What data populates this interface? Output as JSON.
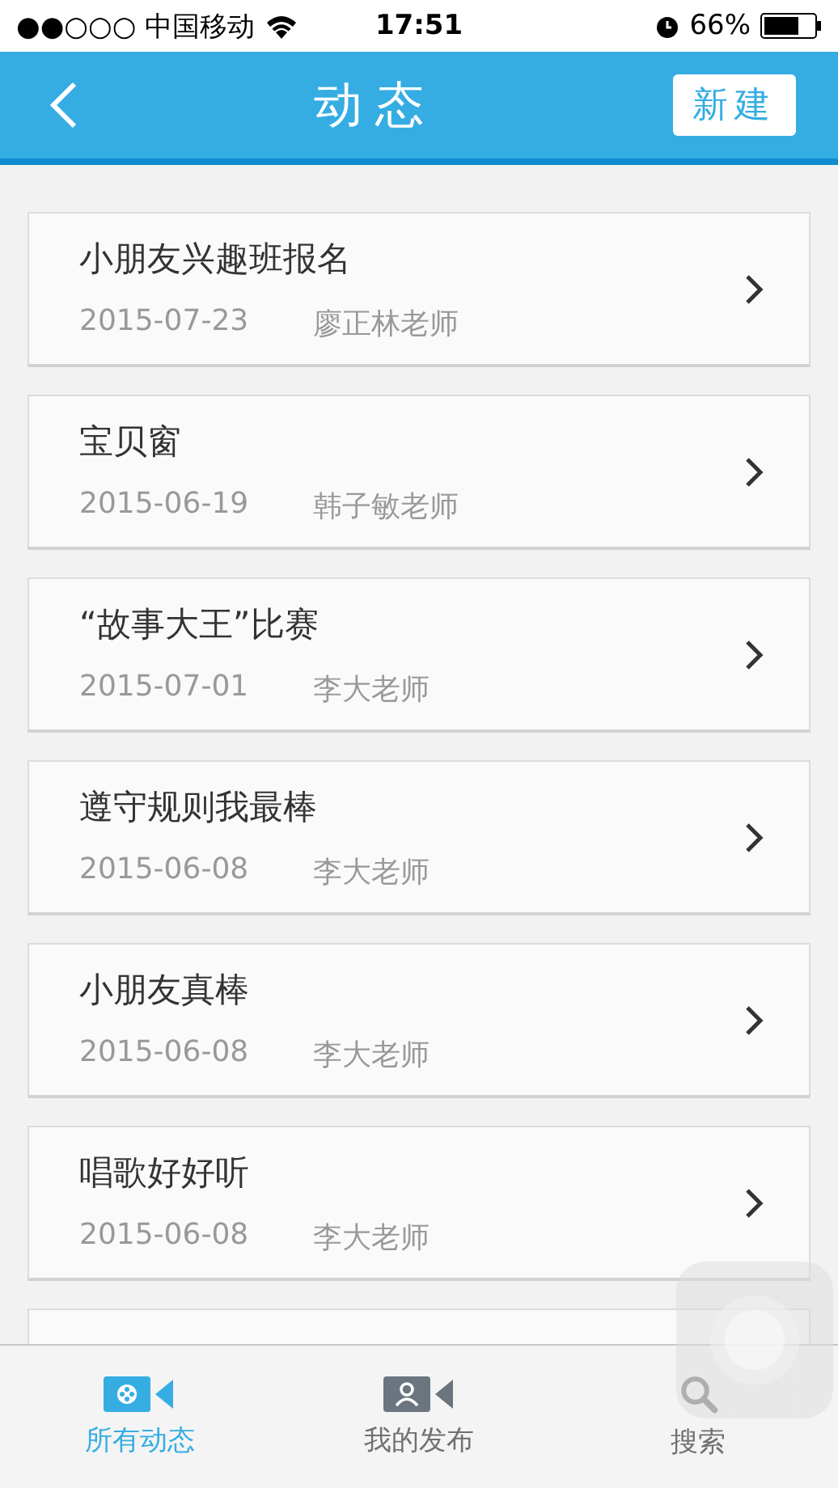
{
  "status_bar": {
    "carrier": "●●○○○ 中国移动",
    "time": "17:51",
    "battery": "66%"
  },
  "nav": {
    "title": "动态",
    "action": "新建"
  },
  "posts": [
    {
      "title": "小朋友兴趣班报名",
      "date": "2015-07-23",
      "author": "廖正林老师"
    },
    {
      "title": "宝贝窗",
      "date": "2015-06-19",
      "author": "韩子敏老师"
    },
    {
      "title": "“故事大王”比赛",
      "date": "2015-07-01",
      "author": "李大老师"
    },
    {
      "title": "遵守规则我最棒",
      "date": "2015-06-08",
      "author": "李大老师"
    },
    {
      "title": "小朋友真棒",
      "date": "2015-06-08",
      "author": "李大老师"
    },
    {
      "title": "唱歌好好听",
      "date": "2015-06-08",
      "author": "李大老师"
    }
  ],
  "tabs": [
    {
      "label": "所有动态",
      "kind": "all",
      "selected": true
    },
    {
      "label": "我的发布",
      "kind": "mine",
      "selected": false
    },
    {
      "label": "搜索",
      "kind": "search",
      "selected": false
    }
  ]
}
